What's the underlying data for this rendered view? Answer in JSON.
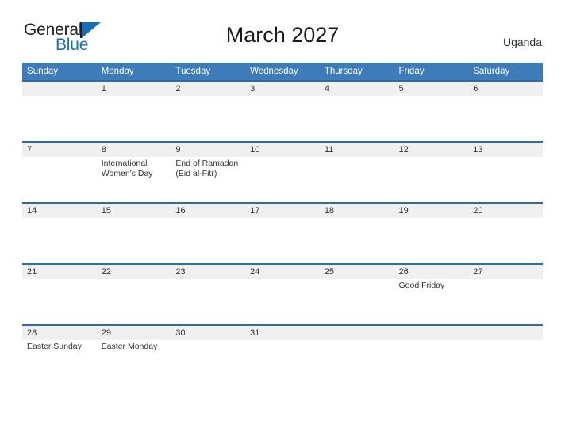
{
  "brand": {
    "word1": "General",
    "word2": "Blue",
    "accent_color": "#1670b8"
  },
  "header": {
    "title": "March 2027",
    "country": "Uganda"
  },
  "theme": {
    "header_blue": "#3d7cb8",
    "rule_blue": "#2e6ca4",
    "daynum_band": "#f0f0f0",
    "text": "#333333"
  },
  "calendar": {
    "month": "March",
    "year": "2027",
    "day_headers": [
      "Sunday",
      "Monday",
      "Tuesday",
      "Wednesday",
      "Thursday",
      "Friday",
      "Saturday"
    ],
    "weeks": [
      {
        "days": [
          {
            "num": "",
            "events": []
          },
          {
            "num": "1",
            "events": []
          },
          {
            "num": "2",
            "events": []
          },
          {
            "num": "3",
            "events": []
          },
          {
            "num": "4",
            "events": []
          },
          {
            "num": "5",
            "events": []
          },
          {
            "num": "6",
            "events": []
          }
        ]
      },
      {
        "days": [
          {
            "num": "7",
            "events": []
          },
          {
            "num": "8",
            "events": [
              "International",
              "Women's Day"
            ]
          },
          {
            "num": "9",
            "events": [
              "End of Ramadan",
              "(Eid al-Fitr)"
            ]
          },
          {
            "num": "10",
            "events": []
          },
          {
            "num": "11",
            "events": []
          },
          {
            "num": "12",
            "events": []
          },
          {
            "num": "13",
            "events": []
          }
        ]
      },
      {
        "days": [
          {
            "num": "14",
            "events": []
          },
          {
            "num": "15",
            "events": []
          },
          {
            "num": "16",
            "events": []
          },
          {
            "num": "17",
            "events": []
          },
          {
            "num": "18",
            "events": []
          },
          {
            "num": "19",
            "events": []
          },
          {
            "num": "20",
            "events": []
          }
        ]
      },
      {
        "days": [
          {
            "num": "21",
            "events": []
          },
          {
            "num": "22",
            "events": []
          },
          {
            "num": "23",
            "events": []
          },
          {
            "num": "24",
            "events": []
          },
          {
            "num": "25",
            "events": []
          },
          {
            "num": "26",
            "events": [
              "Good Friday"
            ]
          },
          {
            "num": "27",
            "events": []
          }
        ]
      },
      {
        "days": [
          {
            "num": "28",
            "events": [
              "Easter Sunday"
            ]
          },
          {
            "num": "29",
            "events": [
              "Easter Monday"
            ]
          },
          {
            "num": "30",
            "events": []
          },
          {
            "num": "31",
            "events": []
          },
          {
            "num": "",
            "events": []
          },
          {
            "num": "",
            "events": []
          },
          {
            "num": "",
            "events": []
          }
        ]
      }
    ]
  }
}
